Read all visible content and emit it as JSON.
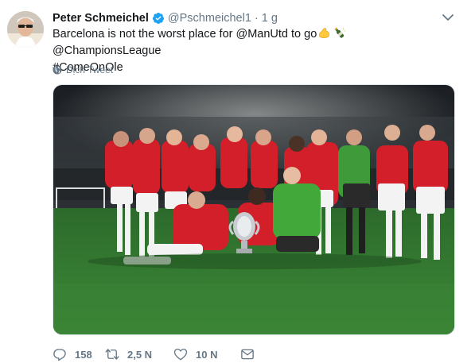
{
  "tweet": {
    "display_name": "Peter Schmeichel",
    "handle": "@Pschmeichel1",
    "separator": "·",
    "time": "1 g",
    "text_part1": "Barcelona is not the worst place for @ManUtd to go",
    "text_part2": "@ChampionsLeague",
    "text_line2": "#ComeOnOle",
    "translate_label": "Dịch Tweet"
  },
  "actions": {
    "reply_count": "158",
    "retweet_count": "2,5 N",
    "like_count": "10 N"
  },
  "icons": {
    "verified": "verified-badge-icon",
    "caret": "chevron-down-icon",
    "globe": "globe-icon",
    "emoji1": "flexed-biceps-emoji",
    "emoji2": "champagne-emoji",
    "reply": "reply-icon",
    "retweet": "retweet-icon",
    "like": "heart-icon",
    "dm": "envelope-icon"
  },
  "colors": {
    "accent": "#1da1f2",
    "muted": "#657786",
    "text": "#14171a",
    "pitch_green": "#2f7a2e",
    "kit_red": "#d21f2a"
  }
}
